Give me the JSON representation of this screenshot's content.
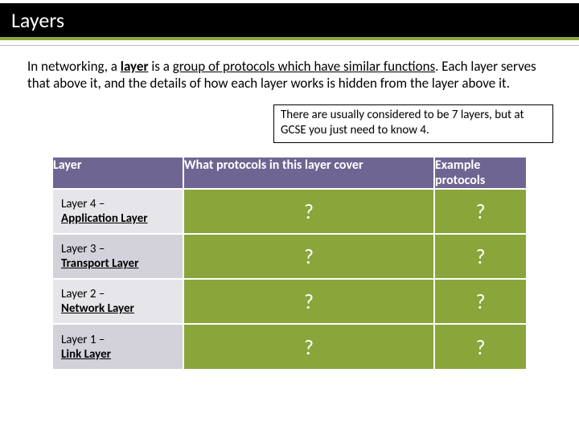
{
  "title": "Layers",
  "intro": {
    "prefix": "In networking, a ",
    "term": "layer",
    "mid": " is a ",
    "definition": "group of protocols which have similar functions",
    "suffix": ". Each layer serves that above it, and the details of how each layer works is hidden from the layer above it."
  },
  "note": "There are usually considered to be 7 layers, but at GCSE you just need to know 4.",
  "table": {
    "headers": {
      "layer": "Layer",
      "cover": "What protocols in this layer cover",
      "examples": "Example protocols"
    },
    "rows": [
      {
        "layer_prefix": "Layer 4 –",
        "layer_name": "Application Layer",
        "cover": "?",
        "examples": "?"
      },
      {
        "layer_prefix": "Layer 3 –",
        "layer_name": "Transport Layer",
        "cover": "?",
        "examples": "?"
      },
      {
        "layer_prefix": "Layer 2 –",
        "layer_name": "Network Layer",
        "cover": "?",
        "examples": "?"
      },
      {
        "layer_prefix": "Layer 1 –",
        "layer_name": "Link Layer",
        "cover": "?",
        "examples": "?"
      }
    ]
  }
}
